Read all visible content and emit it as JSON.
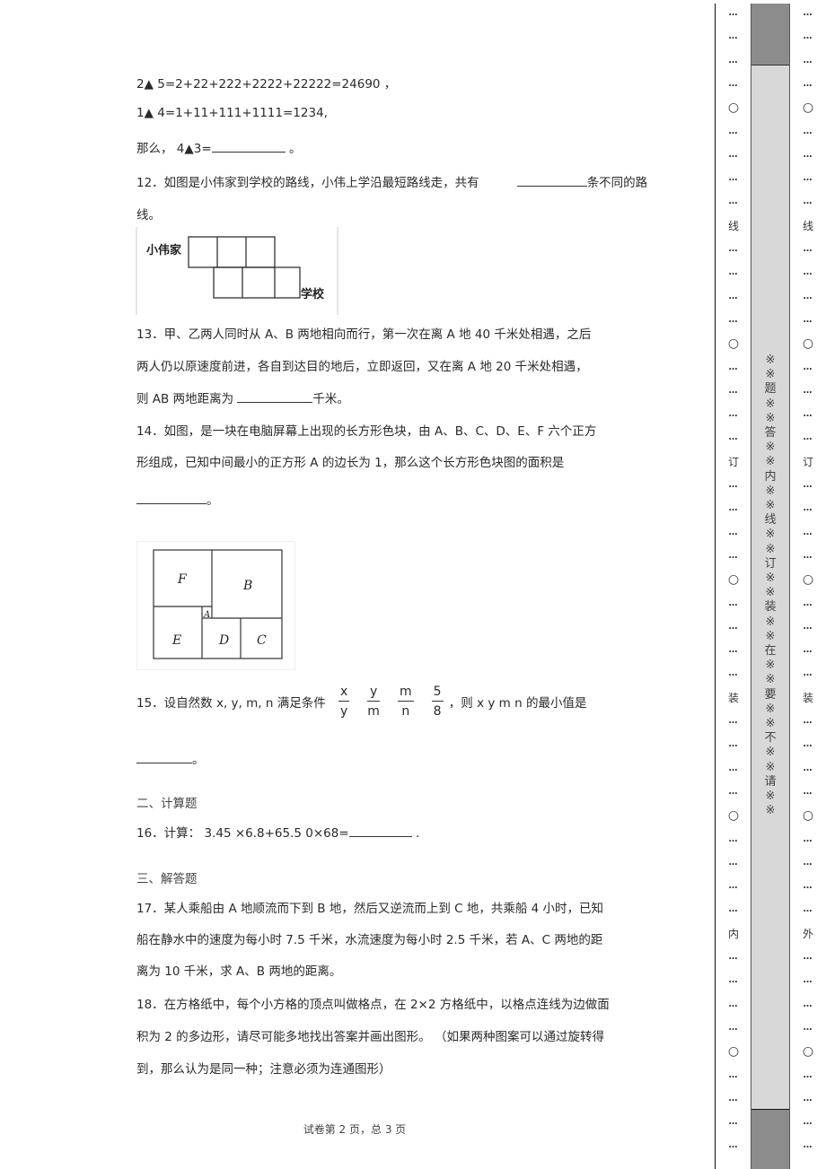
{
  "q11_cont": {
    "line1": "2▲ 5=2+22+222+2222+22222=24690 ，",
    "line2": "1▲ 4=1+11+111+1111=1234,",
    "line3_prefix": "那么，  4▲3=",
    "line3_suffix": " 。"
  },
  "q12": {
    "text_a": "12．如图是小伟家到学校的路线，小伟上学沿最短路线走，共有",
    "text_b": "条不同的路",
    "text_c": "线。",
    "figure_home_label": "小伟家",
    "figure_school_label": "学校"
  },
  "q13": {
    "line1": "13．甲、乙两人同时从    A、B  两地相向而行，第一次在离       A  地  40  千米处相遇，之后",
    "line2": "两人仍以原速度前进，各自到达目的地后，立即返回，又在离          A  地  20  千米处相遇，",
    "line3_prefix": "则  AB  两地距离为  ",
    "line3_suffix": "千米。"
  },
  "q14": {
    "line1": "14．如图，是一块在电脑屏幕上出现的长方形色块，由          A、B、C、D、E、F  六个正方",
    "line2": "形组成，已知中间最小的正方形       A  的边长为   1，那么这个长方形色块图的面积是",
    "line3_suffix": "。",
    "figure_labels": {
      "F": "F",
      "B": "B",
      "A": "A",
      "E": "E",
      "D": "D",
      "C": "C"
    }
  },
  "q15": {
    "prefix": "15．设自然数    x, y, m, n  满足条件",
    "fractions": [
      {
        "num": "x",
        "den": "y"
      },
      {
        "num": "y",
        "den": "m"
      },
      {
        "num": "m",
        "den": "n"
      },
      {
        "num": "5",
        "den": "8"
      }
    ],
    "middle": "，则  x     y     m     n  的最小值是",
    "line2_suffix": "。"
  },
  "section2": {
    "title": "二、计算题"
  },
  "q16": {
    "prefix": "16．计算：  3.45  ×6.8+65.5  0×68=",
    "suffix": " ."
  },
  "section3": {
    "title": "三、解答题"
  },
  "q17": {
    "line1": "17．某人乘船由   A  地顺流而下到   B  地，然后又逆流而上到     C  地，共乘船   4  小时，已知",
    "line2": "船在静水中的速度为每小时      7.5  千米，水流速度为每小时      2.5  千米，若   A、C  两地的距",
    "line3": "离为  10  千米，求  A、B  两地的距离。"
  },
  "q18": {
    "line1": "18．在方格纸中，每个小方格的顶点叫做格点，在         2×2  方格纸中，以格点连线为边做面",
    "line2": "积为  2  的多边形，请尽可能多地找出答案并画出图形。      （如果两种图案可以通过旋转得",
    "line3": "到，那么认为是同一种；注意必须为连通图形）"
  },
  "footer": {
    "text": "试卷第  2 页，总  3 页"
  },
  "binding_margin": {
    "dots": "…",
    "circle": "○",
    "left_column_labels": [
      "线",
      "订",
      "装",
      "内"
    ],
    "right_column_labels": [
      "线",
      "订",
      "装",
      "外"
    ],
    "warning": "※※题※※答※※内※※线※※订※※装※※在※※要※※不※※请※※"
  }
}
